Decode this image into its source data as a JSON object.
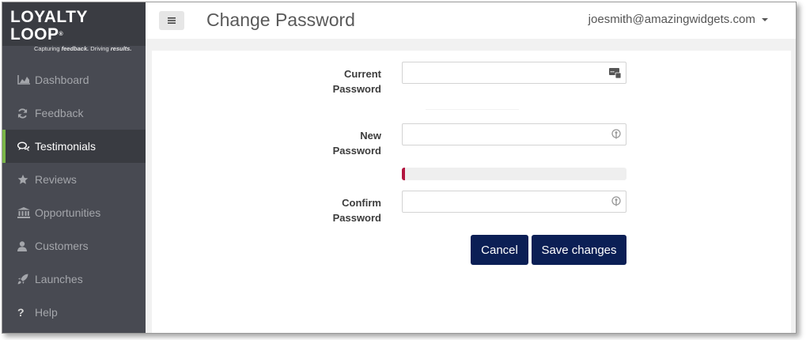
{
  "brand": {
    "logo_text": "LOYALTY LOOP",
    "registered_mark": "®",
    "tagline_prefix": "Capturing ",
    "tagline_bold1": "feedback.",
    "tagline_middle": " Driving ",
    "tagline_bold2": "results."
  },
  "sidebar": {
    "items": [
      {
        "label": "Dashboard",
        "icon": "area-chart-icon"
      },
      {
        "label": "Feedback",
        "icon": "refresh-icon"
      },
      {
        "label": "Testimonials",
        "icon": "comments-icon",
        "active": true
      },
      {
        "label": "Reviews",
        "icon": "star-icon"
      },
      {
        "label": "Opportunities",
        "icon": "bank-icon"
      },
      {
        "label": "Customers",
        "icon": "user-icon"
      },
      {
        "label": "Launches",
        "icon": "rocket-icon"
      },
      {
        "label": "Help",
        "icon": "question-icon"
      }
    ],
    "accent_color": "#7ab648"
  },
  "header": {
    "menu_icon": "hamburger-icon",
    "title": "Change Password",
    "user_email": "joesmith@amazingwidgets.com"
  },
  "form": {
    "current_password": {
      "label_line1": "Current",
      "label_line2": "Password",
      "value": "",
      "icon": "password-manager-icon"
    },
    "new_password": {
      "label_line1": "New",
      "label_line2": "Password",
      "value": "",
      "icon": "key-icon"
    },
    "strength_meter": {
      "level": 0.01,
      "color": "#b2153f"
    },
    "confirm_password": {
      "label_line1": "Confirm",
      "label_line2": "Password",
      "value": "",
      "icon": "key-icon"
    },
    "cancel_label": "Cancel",
    "save_label": "Save changes",
    "button_color": "#0b1f55"
  }
}
